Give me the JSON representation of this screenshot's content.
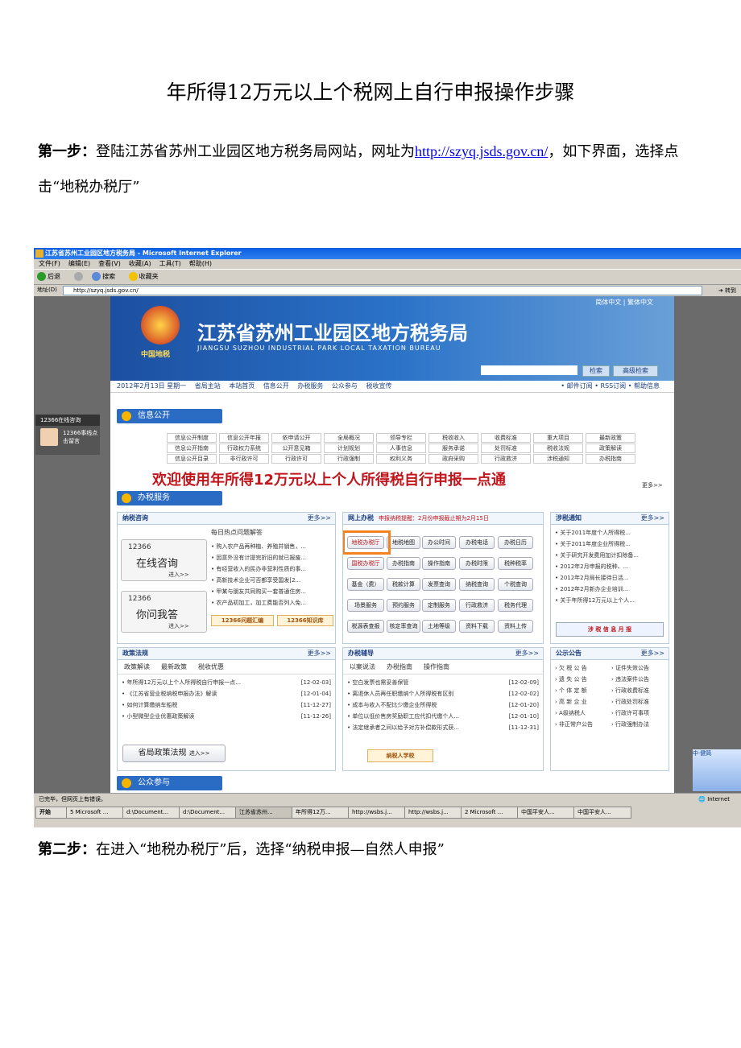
{
  "doc": {
    "title": "年所得12万元以上个税网上自行申报操作步骤",
    "step1_label": "第一步：",
    "step1_text_a": "登陆江苏省苏州工业园区地方税务局网站，网址为",
    "step1_link": "http://szyq.jsds.gov.cn/",
    "step1_text_b": "，如下界面，选择点击“地税办税厅”",
    "step2_label": "第二步：",
    "step2_text": "在进入“地税办税厅”后，选择“纳税申报—自然人申报”"
  },
  "browser": {
    "title": "江苏省苏州工业园区地方税务局 - Microsoft Internet Explorer",
    "menu": [
      "文件(F)",
      "编辑(E)",
      "查看(V)",
      "收藏(A)",
      "工具(T)",
      "帮助(H)"
    ],
    "toolbar": [
      "后退",
      "搜索",
      "收藏夹"
    ],
    "address_label": "地址(D)",
    "address": "http://szyq.jsds.gov.cn/",
    "go": "转到",
    "status": "已完毕，但网页上有错误。",
    "zone": "Internet",
    "taskbar": [
      "开始",
      "5 Microsoft ...",
      "d:\\Document...",
      "d:\\Document...",
      "江苏省苏州...",
      "年所得12万...",
      "http://wsbs.j...",
      "http://wsbs.j...",
      "2 Microsoft ...",
      "中国平安人...",
      "中国平安人..."
    ]
  },
  "site": {
    "name": "江苏省苏州工业园区地方税务局",
    "name_en": "JIANGSU SUZHOU INDUSTRIAL PARK LOCAL TAXATION BUREAU",
    "seal": "中国地税",
    "lang": "简体中文 | 繁体中文",
    "search_btn": "检索",
    "adv_search_btn": "高级检索",
    "date": "2012年2月13日 星期一",
    "nav": [
      "省局主站",
      "本站首页",
      "信息公开",
      "办税服务",
      "公众参与",
      "税收宣传"
    ],
    "nav_right": "• 邮件订阅 • RSS订阅 • 帮助信息",
    "sec_info": "信息公开",
    "info_grid": [
      [
        "信息公开制度",
        "信息公开年报",
        "依申请公开",
        "全局概况",
        "领导专栏",
        "税收收入",
        "收费标准",
        "重大项目",
        "最新政策"
      ],
      [
        "信息公开指南",
        "行政权力系统",
        "公开意见箱",
        "计划规划",
        "人事信息",
        "服务承诺",
        "处罚标准",
        "税收法规",
        "政策解读"
      ],
      [
        "信息公开目录",
        "非行政许可",
        "行政许可",
        "行政强制",
        "权利义务",
        "政府采购",
        "行政救济",
        "涉税通知",
        "办税指南"
      ]
    ],
    "welcome": "欢迎使用年所得12万元以上个人所得税自行申报一点通",
    "more": "更多>>",
    "sec_tax": "办税服务",
    "consult": {
      "title": "纳税咨询",
      "box1_num": "12366",
      "box1_big": "在线咨询",
      "box2_num": "12366",
      "box2_big": "你问我答",
      "enter": "进入>>",
      "hot_title": "每日热点问题解答",
      "hot": [
        "购入农产品再种植、养殖并销售，...",
        "因意外没有计提完折旧的就已报废...",
        "有经营收入的民办非营利性质的事...",
        "高新技术企业可否都享受国发[2...",
        "甲某与朋友共同购买一套普通住房...",
        "农产品初加工，加工费能否列入免..."
      ],
      "btn1": "12366问题汇编",
      "btn2": "12366知识库"
    },
    "online": {
      "title": "网上办税",
      "warn": "申报纳税提醒：2月份申报截止期为2月15日",
      "buttons": [
        [
          "地税办税厅",
          "地税地图",
          "办公时间",
          "办税电话",
          "办税日历"
        ],
        [
          "国税办税厅",
          "办税指南",
          "操作指南",
          "办税时限",
          "税种税率"
        ],
        [
          "基金（费）",
          "税款计算",
          "发票查询",
          "纳税查询",
          "个税查询"
        ],
        [
          "场景服务",
          "预约服务",
          "定制服务",
          "行政救济",
          "税务代理"
        ],
        [
          "税源表查报",
          "核定率查询",
          "土地等级",
          "资料下载",
          "资料上传"
        ]
      ]
    },
    "notice": {
      "title": "涉税通知",
      "items": [
        "关于2011年度个人所得税...",
        "关于2011年度企业所得税...",
        "关于研究开发费用加计扣除备...",
        "2012年2月申报的税种、...",
        "2012年2月局长接待日活...",
        "2012年2月新办企业培训...",
        "关于年所得12万元以上个人..."
      ],
      "btn": "涉 税 信 息 月 报"
    },
    "policy": {
      "title": "政策法规",
      "tabs": [
        "政策解读",
        "最新政策",
        "税收优惠"
      ],
      "items": [
        {
          "t": "年所得12万元以上个人所得税自行申报一点...",
          "d": "[12-02-03]"
        },
        {
          "t": "《江苏省营业税纳税申报办法》解读",
          "d": "[12-01-04]"
        },
        {
          "t": "如何计算缴纳车船税",
          "d": "[11-12-27]"
        },
        {
          "t": "小型微型企业优惠政策解读",
          "d": "[11-12-26]"
        }
      ],
      "foot": "省局政策法规",
      "foot_enter": "进入>>"
    },
    "guide": {
      "title": "办税辅导",
      "tabs": [
        "以案说法",
        "办税指南",
        "操作指南"
      ],
      "items": [
        {
          "t": "空白发票也需妥善保管",
          "d": "[12-02-09]"
        },
        {
          "t": "离退休人员再任职缴纳个人所得税有区别",
          "d": "[12-02-02]"
        },
        {
          "t": "成本与收入不配比少缴企业所得税",
          "d": "[12-01-20]"
        },
        {
          "t": "单位以低价售房奖励职工应代扣代缴个人...",
          "d": "[12-01-10]"
        },
        {
          "t": "法定继承者之间以给予对方补偿款形式获...",
          "d": "[11-12-31]"
        }
      ],
      "foot": "纳税人学校"
    },
    "public": {
      "title": "公示公告",
      "left": [
        "欠 税 公 告",
        "遗 失 公 告",
        "个 体 定 额",
        "高 新 企 业",
        "A级纳税人",
        "非正常户公告"
      ],
      "right": [
        "证件失效公告",
        "违法案件公告",
        "行政收费标准",
        "行政处罚标准",
        "行政许可事项",
        "行政强制办法"
      ]
    },
    "sec_public": "公众参与",
    "side_title": "12366在线咨询",
    "side_text": "12366事线点击留言",
    "chat": "中·健简"
  }
}
